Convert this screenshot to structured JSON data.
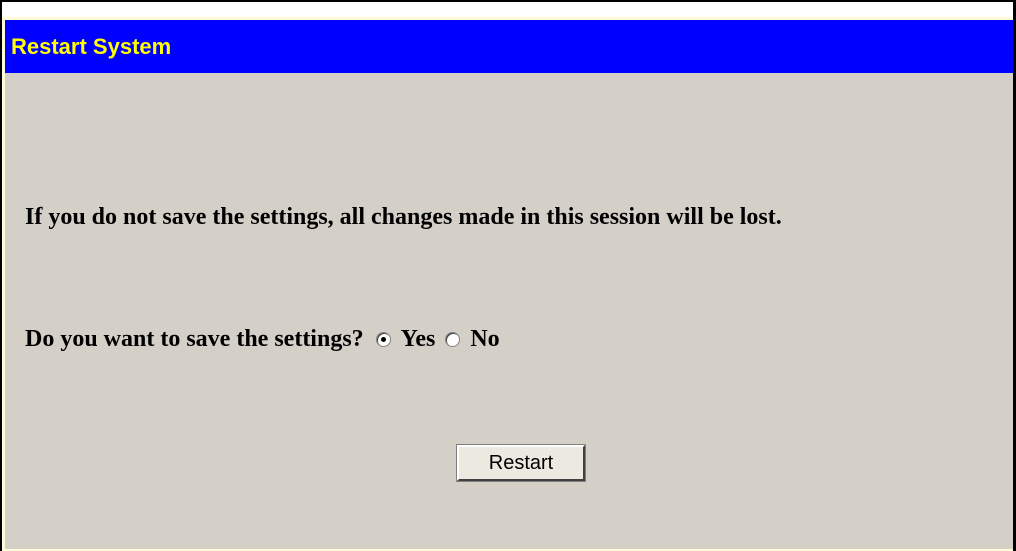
{
  "header": {
    "title": "Restart System"
  },
  "message": {
    "text": "If you do not save the settings, all changes made in this session will be lost."
  },
  "save_prompt": {
    "question": "Do you want to save the settings?",
    "options": [
      {
        "label": "Yes",
        "checked": true
      },
      {
        "label": "No",
        "checked": false
      }
    ]
  },
  "actions": {
    "restart_label": "Restart"
  },
  "colors": {
    "titlebar_bg": "#0000ff",
    "title_text": "#ffff00",
    "panel_bg": "#d4d0c8"
  }
}
